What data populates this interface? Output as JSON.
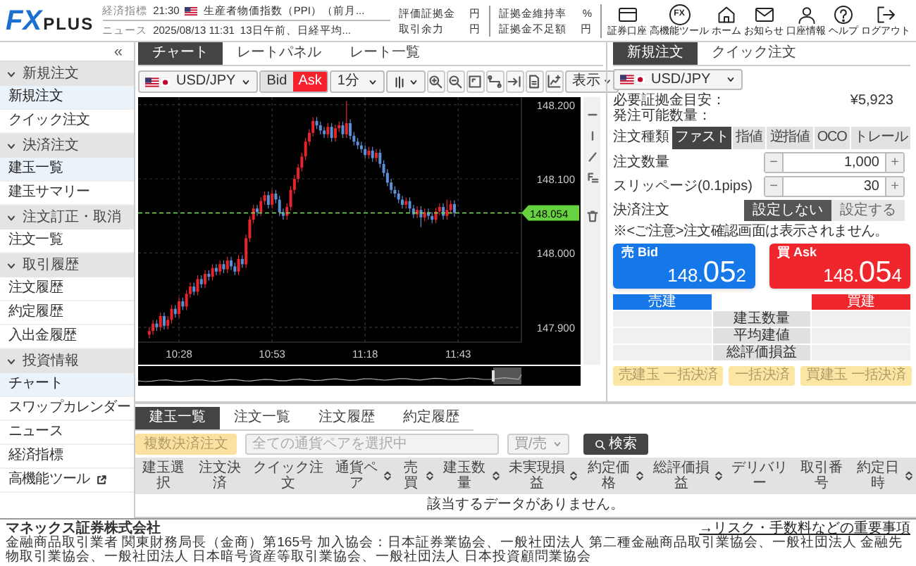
{
  "header": {
    "logo": {
      "mark": "FX",
      "word": "PLUS"
    },
    "tickers": [
      {
        "label": "経済指標",
        "time": "21:30",
        "flag": true,
        "text": "生産者物価指数（PPI）（前月..."
      },
      {
        "label": "ニュース",
        "time": "2025/08/13 11:31",
        "flag": false,
        "text": "13日午前、日経平均..."
      }
    ],
    "account": [
      {
        "label": "評価証拠金",
        "unit": "円"
      },
      {
        "label": "取引余力",
        "unit": "円"
      },
      {
        "label": "証拠金維持率",
        "unit": "%"
      },
      {
        "label": "証拠金不足額",
        "unit": "円"
      }
    ],
    "tools": [
      {
        "kind": "card",
        "label": "証券口座"
      },
      {
        "kind": "fx",
        "glyph": "FX",
        "label": "高機能ツール"
      },
      {
        "kind": "home",
        "label": "ホーム"
      },
      {
        "kind": "mail",
        "label": "お知らせ"
      },
      {
        "kind": "user",
        "label": "口座情報"
      },
      {
        "kind": "help",
        "label": "ヘルプ"
      },
      {
        "kind": "logout",
        "label": "ログアウト"
      }
    ]
  },
  "sidebar": {
    "collapse": "«",
    "groups": [
      {
        "label": "新規注文",
        "expanded": true,
        "items": [
          {
            "label": "新規注文",
            "selected": true,
            "external": false
          },
          {
            "label": "クイック注文",
            "selected": false,
            "external": false
          }
        ]
      },
      {
        "label": "決済注文",
        "expanded": true,
        "items": [
          {
            "label": "建玉一覧",
            "selected": true,
            "external": false
          },
          {
            "label": "建玉サマリー",
            "selected": false,
            "external": false
          }
        ]
      },
      {
        "label": "注文訂正・取消",
        "expanded": true,
        "items": [
          {
            "label": "注文一覧",
            "selected": false,
            "external": false
          }
        ]
      },
      {
        "label": "取引履歴",
        "expanded": true,
        "items": [
          {
            "label": "注文履歴",
            "selected": false,
            "external": false
          },
          {
            "label": "約定履歴",
            "selected": false,
            "external": false
          },
          {
            "label": "入出金履歴",
            "selected": false,
            "external": false
          }
        ]
      },
      {
        "label": "投資情報",
        "expanded": true,
        "items": [
          {
            "label": "チャート",
            "selected": true,
            "external": false
          },
          {
            "label": "スワップカレンダー",
            "selected": false,
            "external": false
          },
          {
            "label": "ニュース",
            "selected": false,
            "external": false
          },
          {
            "label": "経済指標",
            "selected": false,
            "external": false
          },
          {
            "label": "高機能ツール",
            "selected": false,
            "external": true
          }
        ]
      }
    ]
  },
  "chart_panel": {
    "tabs": [
      {
        "label": "チャート",
        "selected": true
      },
      {
        "label": "レートパネル",
        "selected": false
      },
      {
        "label": "レート一覧",
        "selected": false
      }
    ],
    "pair": "USD/JPY",
    "price_sides": [
      {
        "label": "Bid",
        "selected": false
      },
      {
        "label": "Ask",
        "selected": true
      }
    ],
    "interval": "1分",
    "display": "表示",
    "chart_data": {
      "type": "candlestick",
      "xlim": [
        617,
        720
      ],
      "ylim": [
        147.88,
        148.21
      ],
      "grid": true,
      "ref_lines": [
        {
          "axis": "y",
          "value": 148.054,
          "label": "148.054",
          "color": "#7ee05a"
        }
      ],
      "x": [
        620,
        621,
        622,
        623,
        624,
        625,
        626,
        627,
        628,
        629,
        630,
        631,
        632,
        633,
        634,
        635,
        636,
        637,
        638,
        639,
        640,
        641,
        642,
        643,
        644,
        645,
        646,
        647,
        648,
        649,
        650,
        651,
        652,
        653,
        654,
        655,
        656,
        657,
        658,
        659,
        660,
        661,
        662,
        663,
        664,
        665,
        666,
        667,
        668,
        669,
        670,
        671,
        672,
        673,
        674,
        675,
        676,
        677,
        678,
        679,
        680,
        681,
        682,
        683,
        684,
        685,
        686,
        687,
        688,
        689,
        690,
        691,
        692,
        693,
        694,
        695,
        696,
        697,
        698,
        699,
        700,
        701,
        702
      ],
      "ohlc": [
        [
          147.89,
          147.9,
          147.885,
          147.895
        ],
        [
          147.895,
          147.91,
          147.89,
          147.905
        ],
        [
          147.905,
          147.91,
          147.895,
          147.9
        ],
        [
          147.9,
          147.92,
          147.895,
          147.915
        ],
        [
          147.915,
          147.92,
          147.897,
          147.902
        ],
        [
          147.902,
          147.915,
          147.897,
          147.91
        ],
        [
          147.91,
          147.93,
          147.905,
          147.925
        ],
        [
          147.925,
          147.93,
          147.913,
          147.918
        ],
        [
          147.918,
          147.94,
          147.913,
          147.935
        ],
        [
          147.935,
          147.94,
          147.923,
          147.928
        ],
        [
          147.928,
          147.95,
          147.923,
          147.945
        ],
        [
          147.945,
          147.96,
          147.94,
          147.955
        ],
        [
          147.955,
          147.96,
          147.943,
          147.948
        ],
        [
          147.948,
          147.97,
          147.943,
          147.965
        ],
        [
          147.965,
          147.97,
          147.953,
          147.958
        ],
        [
          147.958,
          147.977,
          147.953,
          147.972
        ],
        [
          147.972,
          147.977,
          147.963,
          147.968
        ],
        [
          147.968,
          147.985,
          147.963,
          147.98
        ],
        [
          147.98,
          147.985,
          147.97,
          147.975
        ],
        [
          147.975,
          147.99,
          147.97,
          147.985
        ],
        [
          147.985,
          147.99,
          147.973,
          147.978
        ],
        [
          147.978,
          147.995,
          147.973,
          147.99
        ],
        [
          147.99,
          147.995,
          147.977,
          147.982
        ],
        [
          147.982,
          147.987,
          147.97,
          147.975
        ],
        [
          147.975,
          147.997,
          147.97,
          147.992
        ],
        [
          147.992,
          147.997,
          147.98,
          147.985
        ],
        [
          147.985,
          148.025,
          147.98,
          148.02
        ],
        [
          148.02,
          148.05,
          148.015,
          148.045
        ],
        [
          148.045,
          148.065,
          148.04,
          148.06
        ],
        [
          148.06,
          148.065,
          148.05,
          148.055
        ],
        [
          148.055,
          148.075,
          148.05,
          148.07
        ],
        [
          148.07,
          148.083,
          148.065,
          148.078
        ],
        [
          148.078,
          148.083,
          148.06,
          148.065
        ],
        [
          148.065,
          148.085,
          148.06,
          148.08
        ],
        [
          148.08,
          148.085,
          148.067,
          148.072
        ],
        [
          148.072,
          148.077,
          148.05,
          148.055
        ],
        [
          148.055,
          148.06,
          148.045,
          148.05
        ],
        [
          148.05,
          148.067,
          148.045,
          148.062
        ],
        [
          148.062,
          148.09,
          148.057,
          148.085
        ],
        [
          148.085,
          148.105,
          148.08,
          148.1
        ],
        [
          148.1,
          148.12,
          148.095,
          148.115
        ],
        [
          148.115,
          148.135,
          148.11,
          148.13
        ],
        [
          148.13,
          148.155,
          148.125,
          148.15
        ],
        [
          148.15,
          148.167,
          148.145,
          148.162
        ],
        [
          148.162,
          148.183,
          148.157,
          148.178
        ],
        [
          148.178,
          148.183,
          148.167,
          148.172
        ],
        [
          148.172,
          148.177,
          148.16,
          148.165
        ],
        [
          148.165,
          148.17,
          148.155,
          148.16
        ],
        [
          148.16,
          148.175,
          148.155,
          148.17
        ],
        [
          148.17,
          148.175,
          148.15,
          148.155
        ],
        [
          148.155,
          148.173,
          148.15,
          148.168
        ],
        [
          148.168,
          148.177,
          148.163,
          148.172
        ],
        [
          148.172,
          148.177,
          148.155,
          148.16
        ],
        [
          148.16,
          148.205,
          148.155,
          148.175
        ],
        [
          148.175,
          148.18,
          148.153,
          148.158
        ],
        [
          148.158,
          148.163,
          148.145,
          148.15
        ],
        [
          148.15,
          148.155,
          148.14,
          148.145
        ],
        [
          148.145,
          148.15,
          148.135,
          148.14
        ],
        [
          148.14,
          148.145,
          148.127,
          148.132
        ],
        [
          148.132,
          148.143,
          148.127,
          148.138
        ],
        [
          148.138,
          148.143,
          148.123,
          148.128
        ],
        [
          148.128,
          148.14,
          148.123,
          148.135
        ],
        [
          148.135,
          148.14,
          148.115,
          148.12
        ],
        [
          148.12,
          148.125,
          148.103,
          148.108
        ],
        [
          148.108,
          148.113,
          148.09,
          148.095
        ],
        [
          148.095,
          148.1,
          148.08,
          148.085
        ],
        [
          148.085,
          148.09,
          148.075,
          148.08
        ],
        [
          148.08,
          148.085,
          148.067,
          148.072
        ],
        [
          148.072,
          148.077,
          148.06,
          148.065
        ],
        [
          148.065,
          148.075,
          148.06,
          148.07
        ],
        [
          148.07,
          148.075,
          148.055,
          148.06
        ],
        [
          148.06,
          148.065,
          148.047,
          148.052
        ],
        [
          148.052,
          148.063,
          148.047,
          148.058
        ],
        [
          148.058,
          148.063,
          148.035,
          148.048
        ],
        [
          148.048,
          148.06,
          148.043,
          148.055
        ],
        [
          148.055,
          148.06,
          148.045,
          148.05
        ],
        [
          148.05,
          148.055,
          148.04,
          148.045
        ],
        [
          148.045,
          148.061,
          148.04,
          148.056
        ],
        [
          148.056,
          148.067,
          148.051,
          148.062
        ],
        [
          148.062,
          148.067,
          148.045,
          148.05
        ],
        [
          148.05,
          148.072,
          148.045,
          148.058
        ],
        [
          148.058,
          148.071,
          148.053,
          148.066
        ],
        [
          148.066,
          148.071,
          148.049,
          148.054
        ]
      ],
      "yticks": [
        {
          "value": 148.2,
          "label": "148.200"
        },
        {
          "value": 148.1,
          "label": "148.100"
        },
        {
          "value": 148.0,
          "label": "148.000"
        },
        {
          "value": 147.9,
          "label": "147.900"
        }
      ],
      "xticks": [
        {
          "value": 628,
          "label": "10:28"
        },
        {
          "value": 653,
          "label": "10:53"
        },
        {
          "value": 678,
          "label": "11:18"
        },
        {
          "value": 703,
          "label": "11:43"
        }
      ]
    }
  },
  "order_panel": {
    "tabs": [
      {
        "label": "新規注文",
        "selected": true
      },
      {
        "label": "クイック注文",
        "selected": false
      }
    ],
    "pair": "USD/JPY",
    "margin_label": "必要証拠金目安：",
    "margin_value": "¥5,923",
    "available_label": "発注可能数量：",
    "order_type_label": "注文種類",
    "order_types": [
      {
        "label": "ファスト",
        "selected": true
      },
      {
        "label": "指値",
        "selected": false
      },
      {
        "label": "逆指値",
        "selected": false
      },
      {
        "label": "OCO",
        "selected": false
      },
      {
        "label": "トレール",
        "selected": false
      }
    ],
    "steppers": [
      {
        "label": "注文数量",
        "minus": "−",
        "value": "1,000",
        "plus": "+"
      },
      {
        "label": "スリッページ(0.1pips)",
        "minus": "−",
        "value": "30",
        "plus": "+"
      }
    ],
    "settle_label": "決済注文",
    "settle_options": [
      {
        "label": "設定しない",
        "selected": true
      },
      {
        "label": "設定する",
        "selected": false
      }
    ],
    "note": "※<ご注意>注文確認画面は表示されません。",
    "quotes": [
      {
        "kind": "sell",
        "label": "売 Bid",
        "price_head": "148.",
        "price_big": "05",
        "price_tail": "2"
      },
      {
        "kind": "buy",
        "label": "買 Ask",
        "price_head": "148.",
        "price_big": "05",
        "price_tail": "4"
      }
    ],
    "summary": {
      "sell_header": "売建",
      "buy_header": "買建",
      "rows": [
        "建玉数量",
        "平均建値",
        "総評価損益"
      ]
    },
    "bulk_buttons": [
      {
        "label": "売建玉 一括決済",
        "disabled": true
      },
      {
        "label": "一括決済",
        "disabled": true
      },
      {
        "label": "買建玉 一括決済",
        "disabled": true
      }
    ]
  },
  "positions": {
    "tabs": [
      {
        "label": "建玉一覧",
        "selected": true
      },
      {
        "label": "注文一覧",
        "selected": false
      },
      {
        "label": "注文履歴",
        "selected": false
      },
      {
        "label": "約定履歴",
        "selected": false
      }
    ],
    "bulk_button": {
      "label": "複数決済注文",
      "disabled": true
    },
    "pair_filter": {
      "placeholder": "全ての通貨ペアを選択中"
    },
    "side_filter": "買/売",
    "search_button": "検索",
    "columns": [
      {
        "label": "建玉選択",
        "sortable": false
      },
      {
        "label": "注文決済",
        "sortable": false
      },
      {
        "label": "クイック注文",
        "sortable": false
      },
      {
        "label": "通貨ペア",
        "sortable": true
      },
      {
        "label": "売買",
        "sortable": true
      },
      {
        "label": "建玉数量",
        "sortable": true
      },
      {
        "label": "未実現損益",
        "sortable": true
      },
      {
        "label": "約定価格",
        "sortable": true
      },
      {
        "label": "総評価損益",
        "sortable": true
      },
      {
        "label": "デリバリー",
        "sortable": false
      },
      {
        "label": "取引番号",
        "sortable": false
      },
      {
        "label": "約定日時",
        "sortable": true
      }
    ],
    "empty_message": "該当するデータがありません。"
  },
  "footer": {
    "company": "マネックス証券株式会社",
    "registration": "金融商品取引業者 関東財務局長（金商）第165号 加入協会：日本証券業協会、一般社団法人 第二種金融商品取引業協会、一般社団法人 金融先物取引業協会、一般社団法人 日本暗号資産等取引業協会、一般社団法人 日本投資顧問業協会",
    "risk_link": "→リスク・手数料などの重要事項"
  }
}
